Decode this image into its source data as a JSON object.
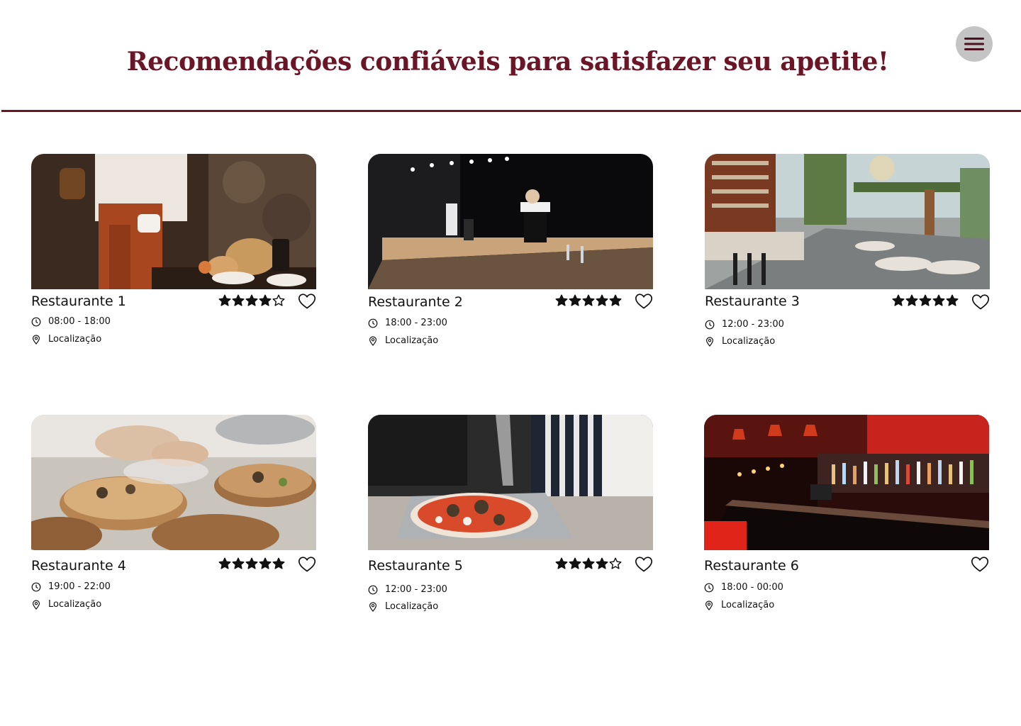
{
  "header": {
    "title": "Recomendações confiáveis para satisfazer seu apetite!",
    "accent_color": "#6b1626",
    "menu_icon": "hamburger-icon"
  },
  "restaurants": [
    {
      "name": "Restaurante 1",
      "hours": "08:00 - 18:00",
      "location": "Localização",
      "rating": 4,
      "rating_max": 5,
      "photo": "coffee-pouring-bread-table"
    },
    {
      "name": "Restaurante 2",
      "hours": "18:00 - 23:00",
      "location": "Localização",
      "rating": 5,
      "rating_max": 5,
      "photo": "dark-chef-counter-bar"
    },
    {
      "name": "Restaurante 3",
      "hours": "12:00 - 23:00",
      "location": "Localização",
      "rating": 5,
      "rating_max": 5,
      "photo": "glass-roof-dining-hall"
    },
    {
      "name": "Restaurante 4",
      "hours": "19:00 - 22:00",
      "location": "Localização",
      "rating": 5,
      "rating_max": 5,
      "photo": "chef-plating-wood-slabs"
    },
    {
      "name": "Restaurante 5",
      "hours": "12:00 - 23:00",
      "location": "Localização",
      "rating": 4,
      "rating_max": 5,
      "photo": "pizza-on-peel"
    },
    {
      "name": "Restaurante 6",
      "hours": "18:00 - 00:00",
      "location": "Localização",
      "rating": null,
      "rating_max": 5,
      "photo": "red-lit-cocktail-bar"
    }
  ]
}
